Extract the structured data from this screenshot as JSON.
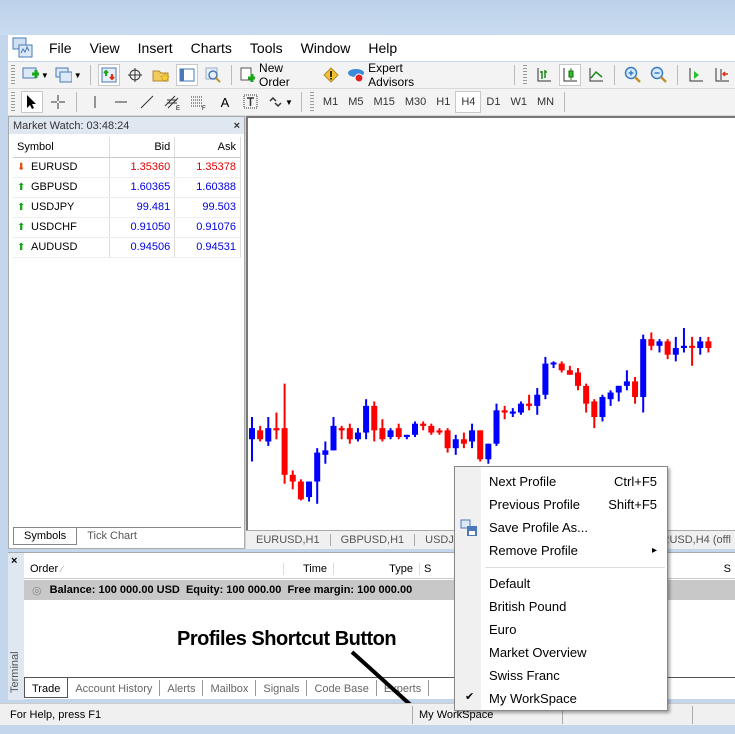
{
  "menubar": {
    "items": [
      "File",
      "View",
      "Insert",
      "Charts",
      "Tools",
      "Window",
      "Help"
    ]
  },
  "toolbar": {
    "new_order": "New Order",
    "expert_advisors": "Expert Advisors",
    "timeframes": [
      "M1",
      "M5",
      "M15",
      "M30",
      "H1",
      "H4",
      "D1",
      "W1",
      "MN"
    ],
    "active_timeframe": "H4"
  },
  "market_watch": {
    "title": "Market Watch: 03:48:24",
    "close": "×",
    "columns": [
      "Symbol",
      "Bid",
      "Ask"
    ],
    "rows": [
      {
        "symbol": "EURUSD",
        "bid": "1.35360",
        "ask": "1.35378",
        "dir": "down",
        "color": "#e00000"
      },
      {
        "symbol": "GBPUSD",
        "bid": "1.60365",
        "ask": "1.60388",
        "dir": "up",
        "color": "#0000e0"
      },
      {
        "symbol": "USDJPY",
        "bid": "99.481",
        "ask": "99.503",
        "dir": "up",
        "color": "#0000e0"
      },
      {
        "symbol": "USDCHF",
        "bid": "0.91050",
        "ask": "0.91076",
        "dir": "up",
        "color": "#0000e0"
      },
      {
        "symbol": "AUDUSD",
        "bid": "0.94506",
        "ask": "0.94531",
        "dir": "up",
        "color": "#0000e0"
      }
    ],
    "tabs": [
      "Symbols",
      "Tick Chart"
    ]
  },
  "chart_tabs": [
    "EURUSD,H1",
    "GBPUSD,H1",
    "USDJPY",
    "RUSD,H4 (offl"
  ],
  "terminal": {
    "close": "×",
    "side_label": "Terminal",
    "columns": [
      "Order",
      "Time",
      "Type",
      "S",
      "S"
    ],
    "balance_line": "Balance: 100 000.00 USD  Equity: 100 000.00  Free margin: 100 000.00",
    "tabs": [
      "Trade",
      "Account History",
      "Alerts",
      "Mailbox",
      "Signals",
      "Code Base",
      "Experts"
    ]
  },
  "annotation": "Profiles Shortcut Button",
  "status": {
    "help": "For Help, press F1",
    "profile": "My WorkSpace"
  },
  "profile_menu": {
    "items": [
      {
        "label": "Next Profile",
        "shortcut": "Ctrl+F5"
      },
      {
        "label": "Previous Profile",
        "shortcut": "Shift+F5"
      },
      {
        "label": "Save Profile As...",
        "shortcut": ""
      },
      {
        "label": "Remove Profile",
        "shortcut": "▸"
      }
    ],
    "profiles": [
      "Default",
      "British Pound",
      "Euro",
      "Market Overview",
      "Swiss Franc",
      "My WorkSpace"
    ],
    "checked": "My WorkSpace",
    "check_mark": "✔"
  },
  "colors": {
    "bull": "#0000ff",
    "bear": "#ff0000"
  },
  "candles": [
    {
      "o": 1.34,
      "h": 1.342,
      "l": 1.338,
      "c": 1.341,
      "bull": true
    },
    {
      "o": 1.3408,
      "h": 1.3412,
      "l": 1.3398,
      "c": 1.34,
      "bull": false
    },
    {
      "o": 1.3398,
      "h": 1.342,
      "l": 1.3394,
      "c": 1.341,
      "bull": true
    },
    {
      "o": 1.341,
      "h": 1.3424,
      "l": 1.34,
      "c": 1.3408,
      "bull": false
    },
    {
      "o": 1.341,
      "h": 1.345,
      "l": 1.336,
      "c": 1.3368,
      "bull": false
    },
    {
      "o": 1.3368,
      "h": 1.3372,
      "l": 1.3355,
      "c": 1.3362,
      "bull": false
    },
    {
      "o": 1.3362,
      "h": 1.3364,
      "l": 1.3345,
      "c": 1.3346,
      "bull": false
    },
    {
      "o": 1.3348,
      "h": 1.3362,
      "l": 1.3344,
      "c": 1.3362,
      "bull": true
    },
    {
      "o": 1.3362,
      "h": 1.3392,
      "l": 1.3342,
      "c": 1.3388,
      "bull": true
    },
    {
      "o": 1.3386,
      "h": 1.3398,
      "l": 1.3378,
      "c": 1.339,
      "bull": true
    },
    {
      "o": 1.339,
      "h": 1.342,
      "l": 1.339,
      "c": 1.3412,
      "bull": true
    },
    {
      "o": 1.341,
      "h": 1.3412,
      "l": 1.34,
      "c": 1.3408,
      "bull": false
    },
    {
      "o": 1.341,
      "h": 1.3414,
      "l": 1.3396,
      "c": 1.34,
      "bull": false
    },
    {
      "o": 1.34,
      "h": 1.341,
      "l": 1.3398,
      "c": 1.3406,
      "bull": true
    },
    {
      "o": 1.3406,
      "h": 1.3436,
      "l": 1.34,
      "c": 1.343,
      "bull": true
    },
    {
      "o": 1.343,
      "h": 1.3434,
      "l": 1.3398,
      "c": 1.3408,
      "bull": false
    },
    {
      "o": 1.341,
      "h": 1.3418,
      "l": 1.3398,
      "c": 1.34,
      "bull": false
    },
    {
      "o": 1.3402,
      "h": 1.341,
      "l": 1.34,
      "c": 1.3408,
      "bull": true
    },
    {
      "o": 1.341,
      "h": 1.3414,
      "l": 1.34,
      "c": 1.3402,
      "bull": false
    },
    {
      "o": 1.3402,
      "h": 1.3404,
      "l": 1.34,
      "c": 1.3404,
      "bull": true
    },
    {
      "o": 1.3404,
      "h": 1.3416,
      "l": 1.3402,
      "c": 1.3414,
      "bull": true
    },
    {
      "o": 1.3414,
      "h": 1.3416,
      "l": 1.3408,
      "c": 1.3412,
      "bull": false
    },
    {
      "o": 1.3412,
      "h": 1.3414,
      "l": 1.3404,
      "c": 1.3406,
      "bull": false
    },
    {
      "o": 1.3408,
      "h": 1.341,
      "l": 1.3404,
      "c": 1.3406,
      "bull": false
    },
    {
      "o": 1.3408,
      "h": 1.341,
      "l": 1.3388,
      "c": 1.3392,
      "bull": false
    },
    {
      "o": 1.3392,
      "h": 1.3404,
      "l": 1.3386,
      "c": 1.34,
      "bull": true
    },
    {
      "o": 1.34,
      "h": 1.3406,
      "l": 1.3392,
      "c": 1.3396,
      "bull": false
    },
    {
      "o": 1.3398,
      "h": 1.3414,
      "l": 1.3392,
      "c": 1.3408,
      "bull": true
    },
    {
      "o": 1.3408,
      "h": 1.3408,
      "l": 1.338,
      "c": 1.3382,
      "bull": false
    },
    {
      "o": 1.3382,
      "h": 1.3396,
      "l": 1.3378,
      "c": 1.3396,
      "bull": true
    },
    {
      "o": 1.3396,
      "h": 1.3432,
      "l": 1.3394,
      "c": 1.3426,
      "bull": true
    },
    {
      "o": 1.3426,
      "h": 1.343,
      "l": 1.3418,
      "c": 1.3424,
      "bull": false
    },
    {
      "o": 1.3423,
      "h": 1.3428,
      "l": 1.342,
      "c": 1.3425,
      "bull": true
    },
    {
      "o": 1.3424,
      "h": 1.3434,
      "l": 1.3422,
      "c": 1.3432,
      "bull": true
    },
    {
      "o": 1.3432,
      "h": 1.344,
      "l": 1.3426,
      "c": 1.343,
      "bull": false
    },
    {
      "o": 1.343,
      "h": 1.3446,
      "l": 1.3422,
      "c": 1.344,
      "bull": true
    },
    {
      "o": 1.344,
      "h": 1.3474,
      "l": 1.3436,
      "c": 1.3468,
      "bull": true
    },
    {
      "o": 1.3468,
      "h": 1.347,
      "l": 1.3464,
      "c": 1.3469,
      "bull": true
    },
    {
      "o": 1.3468,
      "h": 1.347,
      "l": 1.346,
      "c": 1.3462,
      "bull": false
    },
    {
      "o": 1.3462,
      "h": 1.3466,
      "l": 1.3458,
      "c": 1.3458,
      "bull": false
    },
    {
      "o": 1.346,
      "h": 1.3464,
      "l": 1.3444,
      "c": 1.3448,
      "bull": false
    },
    {
      "o": 1.3448,
      "h": 1.345,
      "l": 1.3424,
      "c": 1.3432,
      "bull": false
    },
    {
      "o": 1.3434,
      "h": 1.3436,
      "l": 1.341,
      "c": 1.342,
      "bull": false
    },
    {
      "o": 1.342,
      "h": 1.344,
      "l": 1.3416,
      "c": 1.3438,
      "bull": true
    },
    {
      "o": 1.3436,
      "h": 1.3444,
      "l": 1.343,
      "c": 1.3442,
      "bull": true
    },
    {
      "o": 1.3442,
      "h": 1.3448,
      "l": 1.3434,
      "c": 1.3448,
      "bull": true
    },
    {
      "o": 1.3448,
      "h": 1.3462,
      "l": 1.3444,
      "c": 1.3452,
      "bull": true
    },
    {
      "o": 1.3452,
      "h": 1.3456,
      "l": 1.3432,
      "c": 1.3438,
      "bull": false
    },
    {
      "o": 1.3438,
      "h": 1.3494,
      "l": 1.3424,
      "c": 1.349,
      "bull": true
    },
    {
      "o": 1.349,
      "h": 1.3496,
      "l": 1.348,
      "c": 1.3484,
      "bull": false
    },
    {
      "o": 1.3484,
      "h": 1.349,
      "l": 1.3478,
      "c": 1.3488,
      "bull": true
    },
    {
      "o": 1.3488,
      "h": 1.349,
      "l": 1.3472,
      "c": 1.3476,
      "bull": false
    },
    {
      "o": 1.3476,
      "h": 1.3492,
      "l": 1.347,
      "c": 1.3482,
      "bull": true
    },
    {
      "o": 1.3482,
      "h": 1.35,
      "l": 1.3478,
      "c": 1.3484,
      "bull": true
    },
    {
      "o": 1.3484,
      "h": 1.3492,
      "l": 1.3466,
      "c": 1.3483,
      "bull": false
    },
    {
      "o": 1.3482,
      "h": 1.3492,
      "l": 1.3476,
      "c": 1.3488,
      "bull": true
    },
    {
      "o": 1.3488,
      "h": 1.3492,
      "l": 1.3478,
      "c": 1.3482,
      "bull": false
    }
  ]
}
